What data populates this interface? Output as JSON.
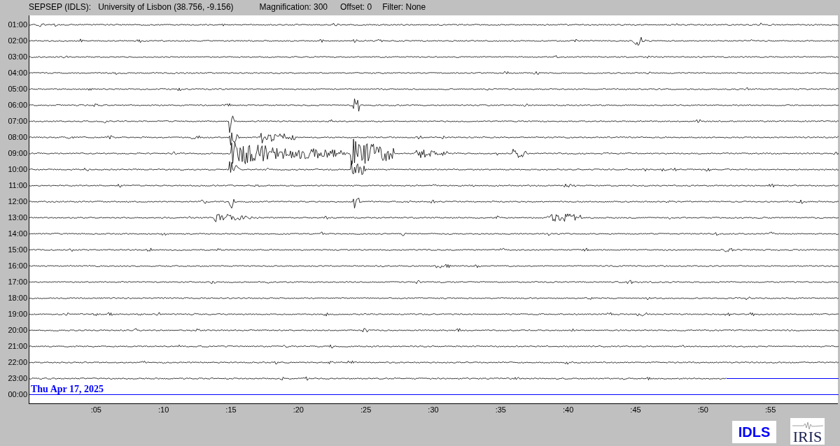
{
  "header": {
    "station": "SEPSEP (IDLS):",
    "location": "University of Lisbon (38.756, -9.156)",
    "magnification": "Magnification: 300",
    "offset": "Offset: 0",
    "filter": "Filter: None"
  },
  "helicorder": {
    "row_labels": [
      "01:00",
      "02:00",
      "03:00",
      "04:00",
      "05:00",
      "06:00",
      "07:00",
      "08:00",
      "09:00",
      "10:00",
      "11:00",
      "12:00",
      "13:00",
      "14:00",
      "15:00",
      "16:00",
      "17:00",
      "18:00",
      "19:00",
      "20:00",
      "21:00",
      "22:00",
      "23:00",
      "00:00"
    ],
    "date": "Thu Apr 17, 2025",
    "minute_labels": [
      ":05",
      ":10",
      ":15",
      ":20",
      ":25",
      ":30",
      ":35",
      ":40",
      ":45",
      ":50",
      ":55"
    ]
  },
  "logos": {
    "station": "IDLS",
    "network": "IRIS"
  }
}
